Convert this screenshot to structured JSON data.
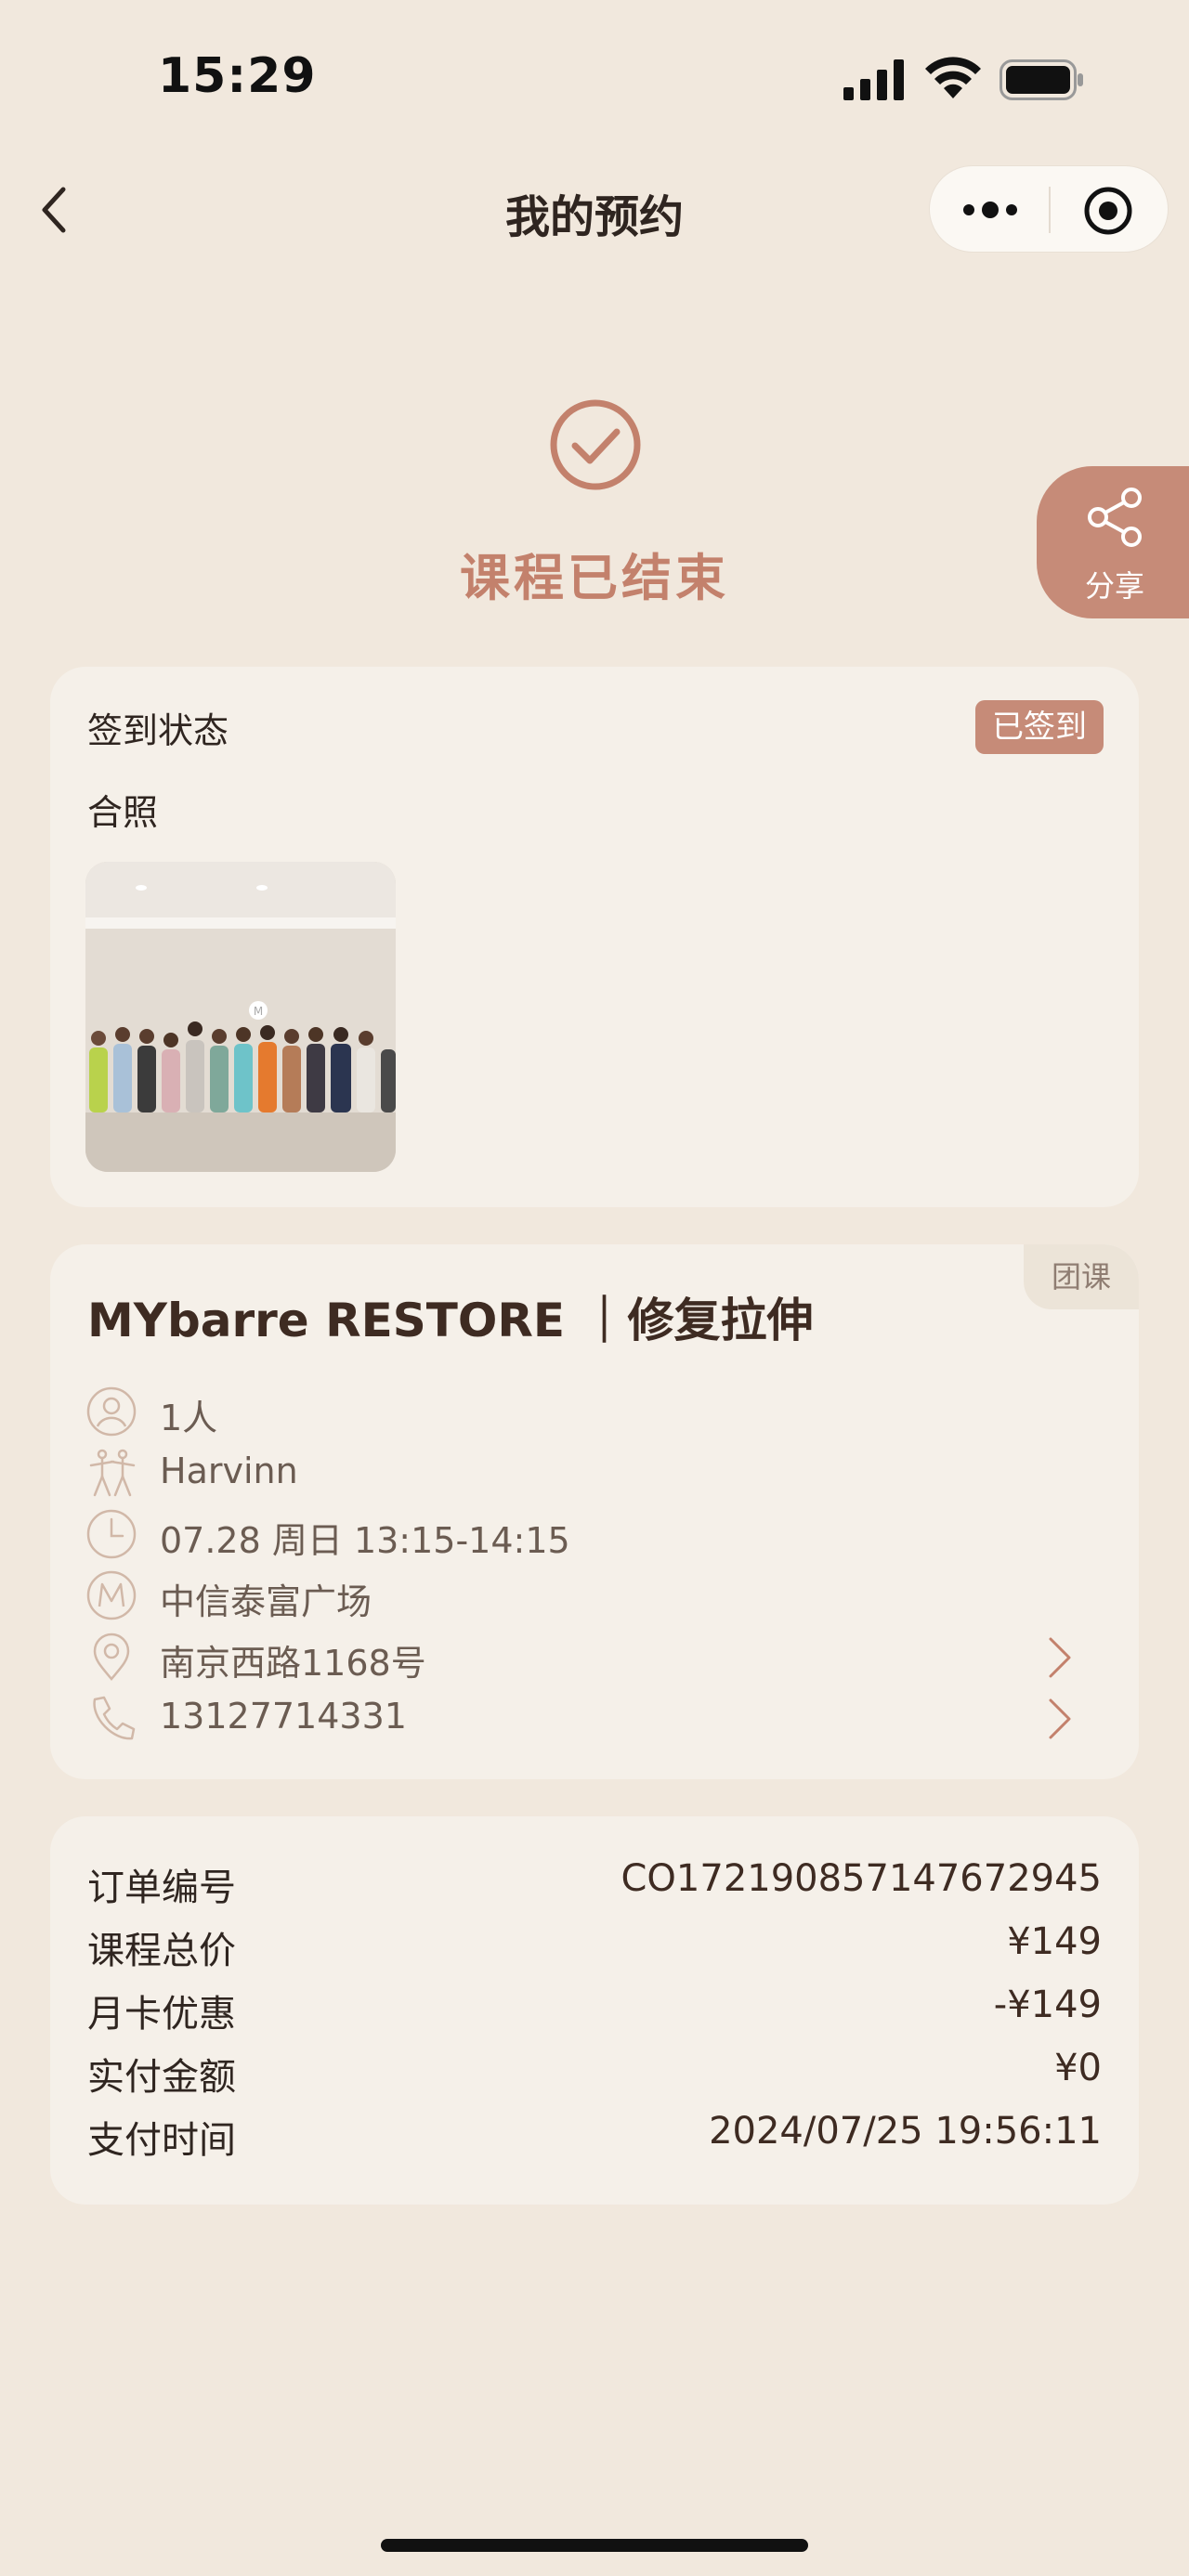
{
  "status_bar": {
    "time": "15:29"
  },
  "nav": {
    "title": "我的预约"
  },
  "finish": {
    "status": "课程已结束"
  },
  "share": {
    "label": "分享"
  },
  "checkin": {
    "label": "签到状态",
    "badge": "已签到",
    "photo_label": "合照"
  },
  "class_info": {
    "tag": "团课",
    "title": "MYbarre RESTORE ｜修复拉伸",
    "people": "1人",
    "coach": "Harvinn",
    "time": "07.28 周日 13:15-14:15",
    "studio": "中信泰富广场",
    "address": "南京西路1168号",
    "phone": "13127714331"
  },
  "order": {
    "rows": [
      {
        "key": "订单编号",
        "value": "CO17219085714767294​5"
      },
      {
        "key": "课程总价",
        "value": "¥149"
      },
      {
        "key": "月卡优惠",
        "value": "-¥149"
      },
      {
        "key": "实付金额",
        "value": "¥0"
      },
      {
        "key": "支付时间",
        "value": "2024/07/25 19:56:11"
      }
    ]
  },
  "colors": {
    "accent": "#c68b78",
    "background": "#f1e8dd",
    "card": "#f5f0e9"
  }
}
